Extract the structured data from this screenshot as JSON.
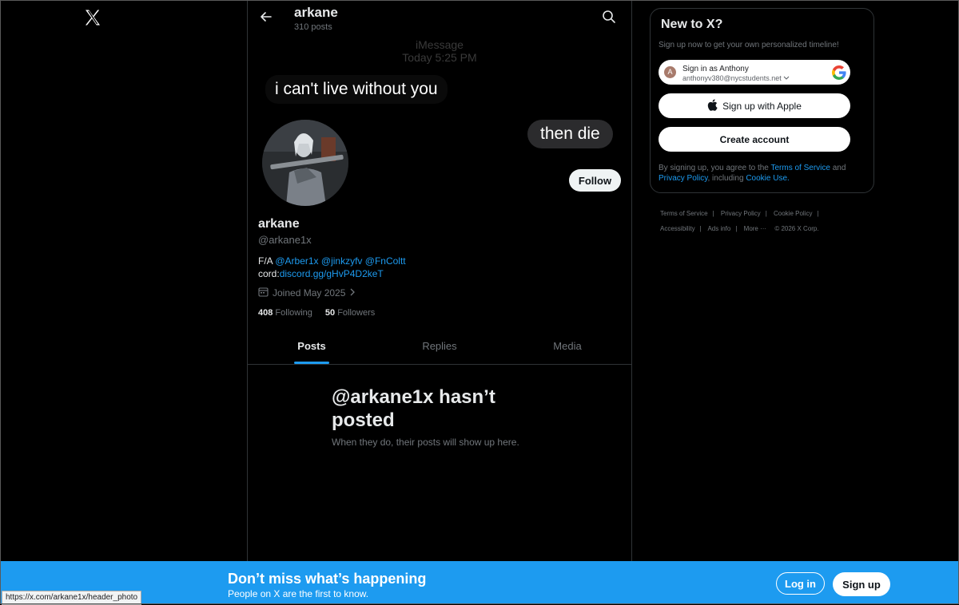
{
  "nav": {
    "logo_icon": "x-logo-icon"
  },
  "header": {
    "name": "arkane",
    "posts_count": "310 posts",
    "back_icon": "arrow-left-icon",
    "search_icon": "search-icon"
  },
  "banner": {
    "imessage_label": "iMessage",
    "imessage_time": "Today 5:25 PM",
    "bubble_left": "i can't live without you",
    "bubble_right": "then die"
  },
  "profile": {
    "follow_label": "Follow",
    "name": "arkane",
    "handle": "@arkane1x",
    "bio_prefix": "F/A ",
    "bio_mentions": [
      "@Arber1x",
      "@jinkzyfv",
      "@FnColtt"
    ],
    "bio_cord_prefix": "cord:",
    "bio_cord_link": "discord.gg/gHvP4D2keT",
    "joined": "Joined May 2025",
    "following_count": "408",
    "following_label": "Following",
    "followers_count": "50",
    "followers_label": "Followers"
  },
  "tabs": [
    {
      "label": "Posts",
      "active": true
    },
    {
      "label": "Replies",
      "active": false
    },
    {
      "label": "Media",
      "active": false
    }
  ],
  "empty_state": {
    "title": "@arkane1x hasn’t posted",
    "subtitle": "When they do, their posts will show up here."
  },
  "signup_panel": {
    "title": "New to X?",
    "subtitle": "Sign up now to get your own personalized timeline!",
    "google_avatar_letter": "A",
    "google_name": "Sign in as Anthony",
    "google_email": "anthonyv380@nycstudents.net",
    "apple_label": "Sign up with Apple",
    "create_label": "Create account",
    "terms_prefix": "By signing up, you agree to the ",
    "terms_link": "Terms of Service",
    "terms_and": " and ",
    "privacy_link": "Privacy Policy",
    "terms_including": ", including ",
    "cookie_link": "Cookie Use."
  },
  "footer": {
    "links": [
      "Terms of Service",
      "Privacy Policy",
      "Cookie Policy",
      "Accessibility",
      "Ads info",
      "More ···"
    ],
    "copyright": "© 2026 X Corp."
  },
  "bottom_bar": {
    "title": "Don’t miss what’s happening",
    "subtitle": "People on X are the first to know.",
    "login_label": "Log in",
    "signup_label": "Sign up"
  },
  "status_bar": {
    "url": "https://x.com/arkane1x/header_photo"
  },
  "colors": {
    "accent": "#1d9bf0",
    "background": "#000000",
    "text": "#e7e9ea",
    "muted": "#71767b"
  }
}
